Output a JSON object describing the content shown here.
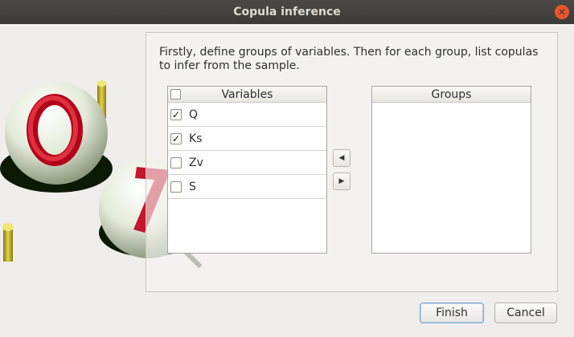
{
  "window": {
    "title": "Copula inference"
  },
  "instructions": "Firstly, define groups of variables. Then for each group, list copulas to infer from the sample.",
  "variables": {
    "header": "Variables",
    "items": [
      {
        "label": "Q",
        "mark": "✓"
      },
      {
        "label": "Ks",
        "mark": "✓"
      },
      {
        "label": "Zv",
        "mark": ""
      },
      {
        "label": "S",
        "mark": ""
      }
    ]
  },
  "groups": {
    "header": "Groups"
  },
  "arrows": {
    "left": "◀",
    "right": "▶"
  },
  "buttons": {
    "finish": "Finish",
    "cancel": "Cancel"
  },
  "icons": {
    "close": "✕"
  }
}
